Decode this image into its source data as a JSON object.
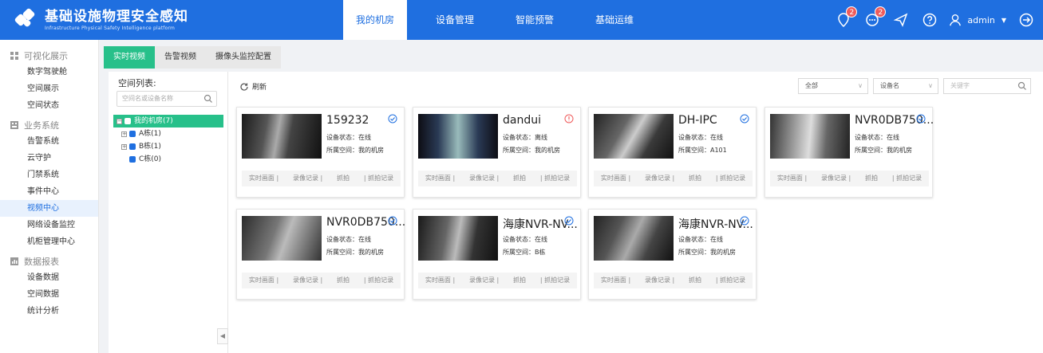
{
  "header": {
    "title": "基础设施物理安全感知",
    "subtitle": "Infrastructure Physical Safety Intelligence platform",
    "nav": [
      "我的机房",
      "设备管理",
      "智能预警",
      "基础运维"
    ],
    "active_nav": 0,
    "badges": {
      "alerts": "2",
      "messages": "2"
    },
    "user": "admin"
  },
  "sidebar": {
    "groups": [
      {
        "label": "可视化展示",
        "icon": "grid-icon",
        "items": [
          "数字驾驶舱",
          "空间展示",
          "空间状态"
        ]
      },
      {
        "label": "业务系统",
        "icon": "business-icon",
        "items": [
          "告警系统",
          "云守护",
          "门禁系统",
          "事件中心",
          "视频中心",
          "网络设备监控",
          "机柜管理中心"
        ]
      },
      {
        "label": "数据报表",
        "icon": "report-icon",
        "items": [
          "设备数据",
          "空间数据",
          "统计分析"
        ]
      }
    ],
    "active_item": "视频中心"
  },
  "tabs": [
    "实时视频",
    "告警视频",
    "摄像头监控配置"
  ],
  "left_panel": {
    "title": "空间列表:",
    "search_placeholder": "空间名或设备名称",
    "tree_root": "我的机房(7)",
    "tree_nodes": [
      "A栋(1)",
      "B栋(1)",
      "C栋(0)"
    ]
  },
  "toolbar": {
    "refresh": "刷新",
    "filter_all": "全部",
    "filter_device": "设备名",
    "keyword_placeholder": "关键字"
  },
  "colors": {
    "primary": "#1f6fe0",
    "accent": "#27c08a",
    "danger": "#ef5b5b"
  },
  "cards": [
    {
      "name": "159232",
      "status": "设备状态：在线",
      "space": "所属空间：我的机房",
      "state_icon": "check-circle-icon"
    },
    {
      "name": "dandui",
      "status": "设备状态：离线",
      "space": "所属空间：我的机房",
      "state_icon": "alert-circle-icon"
    },
    {
      "name": "DH-IPC",
      "status": "设备状态：在线",
      "space": "所属空间：A101",
      "state_icon": "check-circle-icon"
    },
    {
      "name": "NVR0DB750...",
      "status": "设备状态：在线",
      "space": "所属空间：我的机房",
      "state_icon": "check-circle-icon"
    },
    {
      "name": "NVR0DB750...",
      "status": "设备状态：在线",
      "space": "所属空间：我的机房",
      "state_icon": "check-circle-icon"
    },
    {
      "name": "海康NVR-NV...",
      "status": "设备状态：在线",
      "space": "所属空间：B栋",
      "state_icon": "check-circle-icon"
    },
    {
      "name": "海康NVR-NV...",
      "status": "设备状态：在线",
      "space": "所属空间：我的机房",
      "state_icon": "check-circle-icon"
    }
  ],
  "card_actions": [
    "实时画面 |",
    "录像记录 |",
    "抓拍",
    "| 抓拍记录"
  ]
}
